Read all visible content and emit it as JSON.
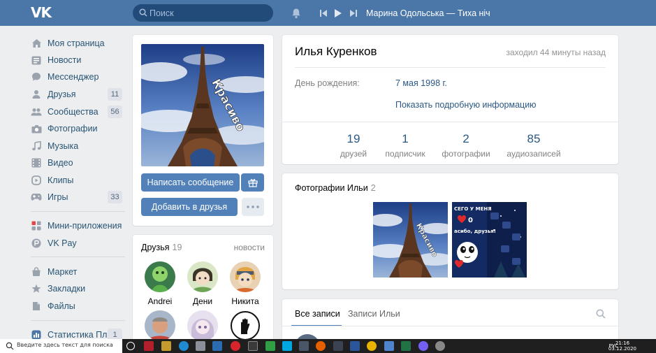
{
  "header": {
    "logo": "VK",
    "search_placeholder": "Поиск",
    "now_playing": "Марина Одольська — Тиха ніч"
  },
  "nav": {
    "items": [
      {
        "label": "Моя страница",
        "icon": "home-icon"
      },
      {
        "label": "Новости",
        "icon": "news-icon"
      },
      {
        "label": "Мессенджер",
        "icon": "messenger-icon"
      },
      {
        "label": "Друзья",
        "icon": "friends-icon",
        "count": "11"
      },
      {
        "label": "Сообщества",
        "icon": "communities-icon",
        "count": "56"
      },
      {
        "label": "Фотографии",
        "icon": "camera-icon"
      },
      {
        "label": "Музыка",
        "icon": "music-icon"
      },
      {
        "label": "Видео",
        "icon": "video-icon"
      },
      {
        "label": "Клипы",
        "icon": "clips-icon"
      },
      {
        "label": "Игры",
        "icon": "games-icon",
        "count": "33"
      },
      {
        "label": "Мини-приложения",
        "icon": "mini-apps-icon"
      },
      {
        "label": "VK Pay",
        "icon": "vkpay-icon"
      },
      {
        "label": "Маркет",
        "icon": "market-icon"
      },
      {
        "label": "Закладки",
        "icon": "star-icon"
      },
      {
        "label": "Файлы",
        "icon": "files-icon"
      },
      {
        "label": "Статистика Плюс",
        "icon": "stats-icon",
        "count": "1"
      }
    ]
  },
  "avatar": {
    "photo_text": "Красиво",
    "write_button": "Написать сообщение",
    "add_friend_button": "Добавить в друзья"
  },
  "friends": {
    "title": "Друзья",
    "count": "19",
    "more": "новости",
    "list": [
      {
        "name": "Andrei"
      },
      {
        "name": "Дени"
      },
      {
        "name": "Никита"
      },
      {
        "name": ""
      },
      {
        "name": ""
      },
      {
        "name": ""
      }
    ]
  },
  "profile": {
    "name": "Илья Куренков",
    "last_seen": "заходил 44 минуты назад",
    "birthday_label": "День рождения:",
    "birthday_value": "7 мая 1998 г.",
    "more_info": "Показать подробную информацию",
    "stats": [
      {
        "value": "19",
        "label": "друзей"
      },
      {
        "value": "1",
        "label": "подписчик"
      },
      {
        "value": "2",
        "label": "фотографии"
      },
      {
        "value": "85",
        "label": "аудиозаписей"
      }
    ]
  },
  "photos": {
    "title": "Фотографии Ильи",
    "count": "2",
    "second_photo": {
      "line1": "СЕГО У МЕНЯ",
      "heart_count": "0",
      "line2": "асибо, друзья!"
    }
  },
  "wall": {
    "tab_all": "Все записи",
    "tab_own": "Записи Ильи"
  },
  "taskbar": {
    "search_text": "Введите здесь текст для поиска",
    "lang": "РУС",
    "time": "21:16",
    "date": "03.12.2020"
  },
  "colors": {
    "header": "#4a76a8",
    "link": "#2a5885",
    "button": "#5181b8",
    "page_bg": "#edeef0"
  }
}
